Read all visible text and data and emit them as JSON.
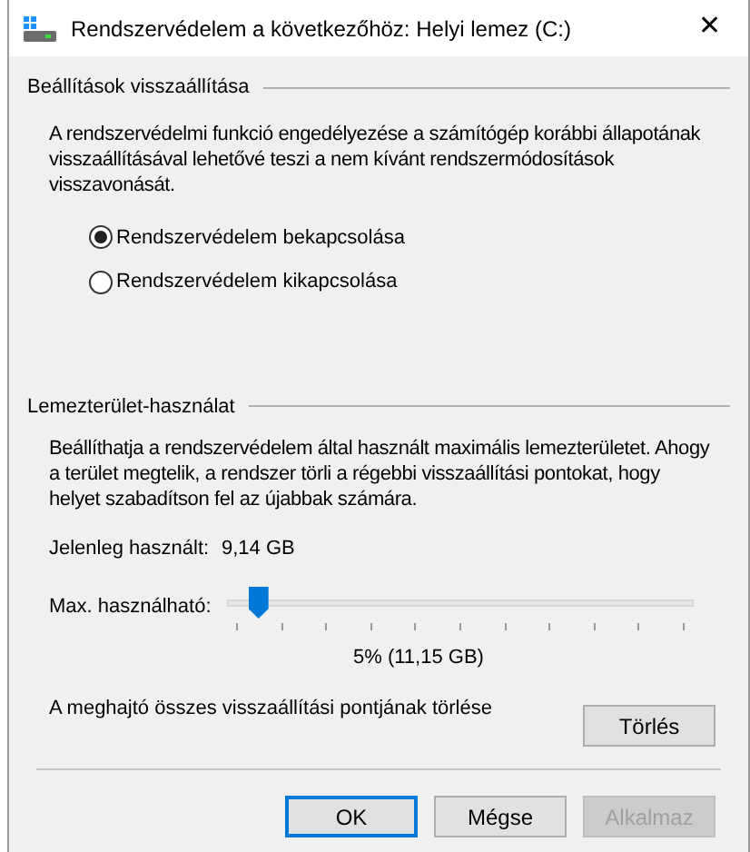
{
  "window": {
    "title": "Rendszervédelem a következőhöz: Helyi lemez (C:)",
    "close": "✕"
  },
  "restore_settings": {
    "heading": "Beállítások visszaállítása",
    "description": "A rendszervédelmi funkció engedélyezése a számítógép korábbi állapotának visszaállításával lehetővé teszi a nem kívánt rendszermódosítások visszavonását.",
    "options": [
      {
        "label": "Rendszervédelem bekapcsolása",
        "selected": true
      },
      {
        "label": "Rendszervédelem kikapcsolása",
        "selected": false
      }
    ]
  },
  "disk_usage": {
    "heading": "Lemezterület-használat",
    "description": "Beállíthatja a rendszervédelem által használt maximális lemezterületet. Ahogy a terület megtelik, a rendszer törli a régebbi visszaállítási pontokat, hogy helyet szabadítson fel az újabbak számára.",
    "current_label": "Jelenleg használt:",
    "current_value": "9,14 GB",
    "max_label": "Max. használható:",
    "max_slider": {
      "level": 0.05
    },
    "max_reading": "5% (11,15 GB)",
    "delete_text": "A meghajtó összes visszaállítási pontjának törlése",
    "delete_button": "Törlés"
  },
  "buttons": [
    {
      "label": "OK",
      "default": true,
      "disabled": false
    },
    {
      "label": "Mégse",
      "default": false,
      "disabled": false
    },
    {
      "label": "Alkalmaz",
      "default": false,
      "disabled": true
    }
  ]
}
